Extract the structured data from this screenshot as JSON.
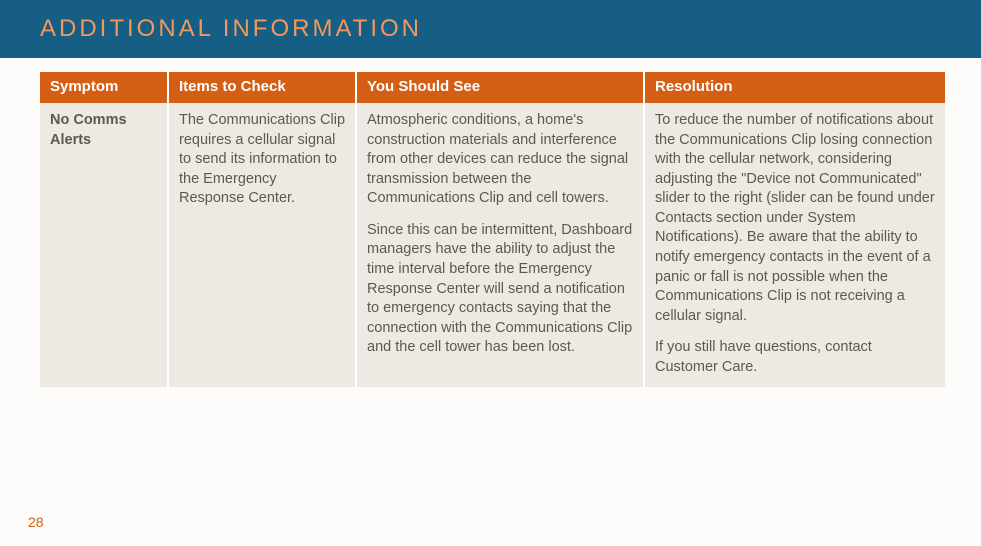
{
  "header": {
    "title": "ADDITIONAL INFORMATION"
  },
  "table": {
    "headers": {
      "symptom": "Symptom",
      "items": "Items to Check",
      "see": "You Should See",
      "resolution": "Resolution"
    },
    "row": {
      "symptom": "No Comms Alerts",
      "items": "The Communications Clip requires a cellular signal to send its information to the Emergency Response Center.",
      "see_p1": "Atmospheric conditions, a home's construction materials and interference from other devices can reduce the signal transmission between the Communications Clip and cell towers.",
      "see_p2": "Since this can be intermittent, Dashboard managers have the ability to adjust the time interval before the Emergency Response Center will send a notification to emergency contacts saying that the connection with the Communications Clip and the cell tower has been lost.",
      "res_p1": "To reduce the number of notifications about the Communications Clip losing connection with the cellular network, considering adjusting the \"Device not Communicated\" slider to the right (slider can be found under Contacts section under System Notifications). Be aware that the ability to notify emergency contacts in the event of a panic or fall is not possible when the Communications Clip is not receiving a cellular signal.",
      "res_p2": "If you still have questions, contact Customer Care."
    }
  },
  "page_number": "28"
}
